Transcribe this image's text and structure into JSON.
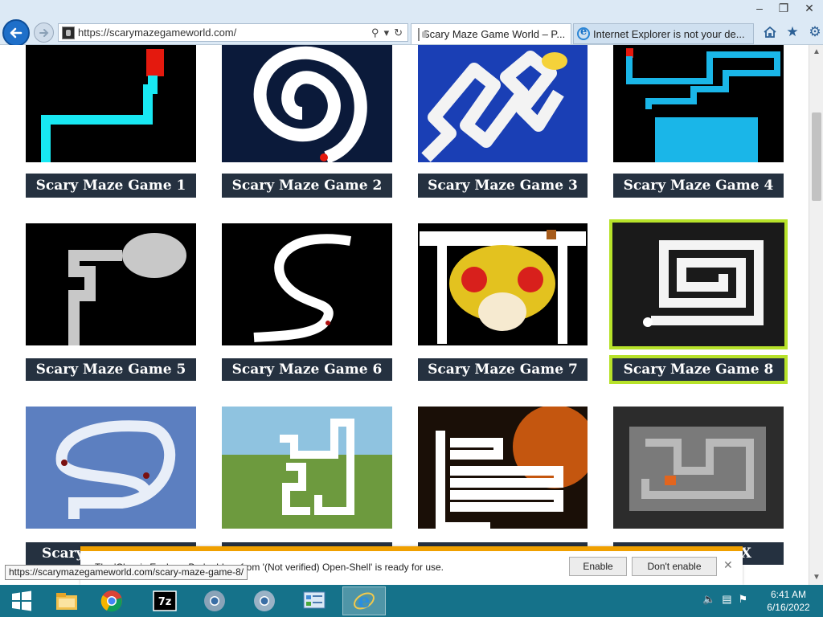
{
  "browser": {
    "address_url": "https://scarymazegameworld.com/",
    "tabs": [
      {
        "title": "Scary Maze Game World – P..."
      },
      {
        "title": "Internet Explorer is not your de..."
      }
    ],
    "window_controls": {
      "minimize": "–",
      "maximize": "❐",
      "close": "✕"
    }
  },
  "games": [
    {
      "label": "Scary Maze Game 1",
      "icon": "maze-thumbnail"
    },
    {
      "label": "Scary Maze Game 2",
      "icon": "maze-thumbnail"
    },
    {
      "label": "Scary Maze Game 3",
      "icon": "maze-thumbnail"
    },
    {
      "label": "Scary Maze Game 4",
      "icon": "maze-thumbnail"
    },
    {
      "label": "Scary Maze Game 5",
      "icon": "maze-thumbnail"
    },
    {
      "label": "Scary Maze Game 6",
      "icon": "maze-thumbnail"
    },
    {
      "label": "Scary Maze Game 7",
      "icon": "maze-thumbnail"
    },
    {
      "label": "Scary Maze Game 8",
      "icon": "maze-thumbnail",
      "highlighted": true
    },
    {
      "label": "Scary",
      "icon": "maze-thumbnail"
    },
    {
      "label": "",
      "icon": "maze-thumbnail"
    },
    {
      "label": "",
      "icon": "maze-thumbnail"
    },
    {
      "label": "X",
      "icon": "maze-thumbnail"
    }
  ],
  "notification": {
    "text": "The 'Classic Explorer Bar' add-on from '(Not verified) Open-Shell' is ready for use.",
    "enable_label": "Enable",
    "dont_enable_label": "Don't enable"
  },
  "status_tooltip": "https://scarymazegameworld.com/scary-maze-game-8/",
  "taskbar": {
    "time": "6:41 AM",
    "date": "6/16/2022",
    "apps": [
      "windows-start",
      "file-explorer",
      "chrome",
      "7-zip",
      "chrome-canary",
      "chrome-beta",
      "control-panel",
      "internet-explorer"
    ]
  },
  "colors": {
    "accent_frame": "#b7e22a",
    "label_bg": "#253140",
    "notification_bar": "#f0a000",
    "taskbar": "#15728a"
  }
}
